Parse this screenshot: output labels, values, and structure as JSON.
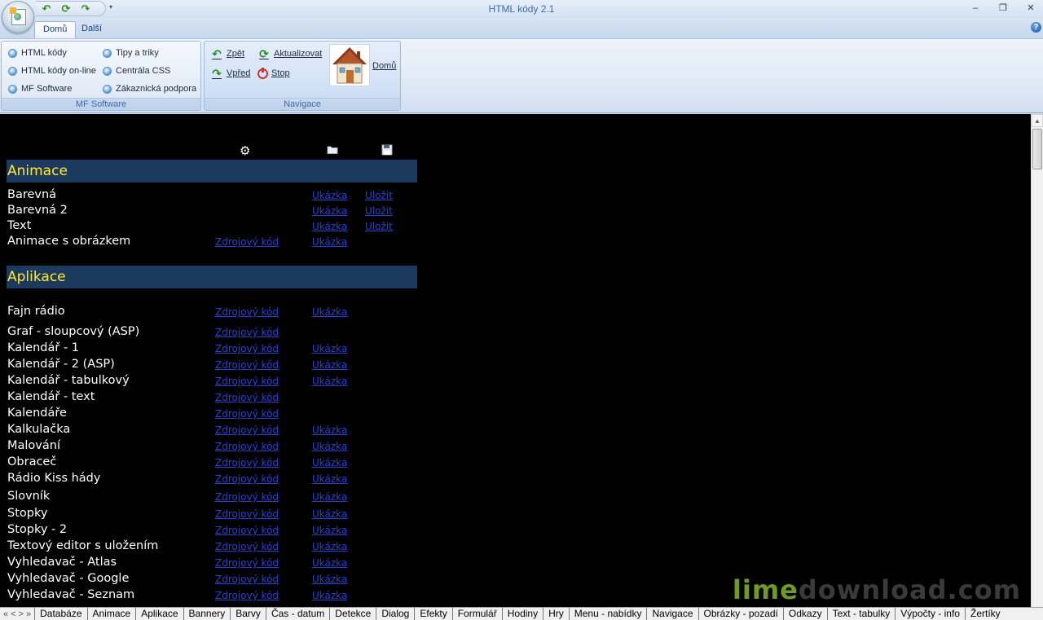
{
  "window": {
    "title": "HTML kódy 2.1",
    "controls": [
      "–",
      "❐",
      "✕"
    ]
  },
  "tabs": [
    {
      "label": "Domů",
      "active": true
    },
    {
      "label": "Další",
      "active": false
    }
  ],
  "ribbon": {
    "mf_group": {
      "label": "MF Software",
      "items": [
        "HTML kódy",
        "HTML kódy on-line",
        "MF Software",
        "Tipy a triky",
        "Centrála CSS",
        "Zákaznická podpora"
      ]
    },
    "nav_group": {
      "label": "Navigace",
      "back": "Zpět",
      "forward": "Vpřed",
      "refresh": "Aktualizovat",
      "stop": "Stop",
      "home": "Domů"
    }
  },
  "content": {
    "sections": [
      {
        "title": "Animace",
        "rows": [
          {
            "name": "Barevná",
            "source": null,
            "demo": "Ukázka",
            "save": "Uložit"
          },
          {
            "name": "Barevná 2",
            "source": null,
            "demo": "Ukázka",
            "save": "Uložit"
          },
          {
            "name": "Text",
            "source": null,
            "demo": "Ukázka",
            "save": "Uložit"
          },
          {
            "name": "Animace s obrázkem",
            "source": "Zdrojový kód",
            "demo": "Ukázka",
            "save": null
          }
        ]
      },
      {
        "title": "Aplikace",
        "rows": [
          {
            "name": "Fajn rádio",
            "source": "Zdrojový kód",
            "demo": "Ukázka"
          },
          {
            "name": "Graf - sloupcový (ASP)",
            "source": "Zdrojový kód",
            "demo": null
          },
          {
            "name": "Kalendář - 1",
            "source": "Zdrojový kód",
            "demo": "Ukázka"
          },
          {
            "name": "Kalendář - 2 (ASP)",
            "source": "Zdrojový kód",
            "demo": "Ukázka"
          },
          {
            "name": "Kalendář - tabulkový",
            "source": "Zdrojový kód",
            "demo": "Ukázka"
          },
          {
            "name": "Kalendář - text",
            "source": "Zdrojový kód",
            "demo": null
          },
          {
            "name": "Kalendáře",
            "source": "Zdrojový kód",
            "demo": null
          },
          {
            "name": "Kalkulačka",
            "source": "Zdrojový kód",
            "demo": "Ukázka"
          },
          {
            "name": "Malování",
            "source": "Zdrojový kód",
            "demo": "Ukázka"
          },
          {
            "name": "Obraceč",
            "source": "Zdrojový kód",
            "demo": "Ukázka"
          },
          {
            "name": "Rádio Kiss hády",
            "source": "Zdrojový kód",
            "demo": "Ukázka"
          },
          {
            "name": "Slovník",
            "source": "Zdrojový kód",
            "demo": "Ukázka"
          },
          {
            "name": "Stopky",
            "source": "Zdrojový kód",
            "demo": "Ukázka"
          },
          {
            "name": "Stopky - 2",
            "source": "Zdrojový kód",
            "demo": "Ukázka"
          },
          {
            "name": "Textový editor s uložením",
            "source": "Zdrojový kód",
            "demo": "Ukázka"
          },
          {
            "name": "Vyhledavač - Atlas",
            "source": "Zdrojový kód",
            "demo": "Ukázka"
          },
          {
            "name": "Vyhledavač - Google",
            "source": "Zdrojový kód",
            "demo": "Ukázka"
          },
          {
            "name": "Vyhledavač - Seznam",
            "source": "Zdrojový kód",
            "demo": "Ukázka"
          }
        ]
      }
    ]
  },
  "watermark": {
    "part1": "lime",
    "part2": "download.com"
  },
  "bottom_tabs": [
    "Databáze",
    "Animace",
    "Aplikace",
    "Bannery",
    "Barvy",
    "Čas - datum",
    "Detekce",
    "Dialog",
    "Efekty",
    "Formulář",
    "Hodiny",
    "Hry",
    "Menu - nabídky",
    "Navigace",
    "Obrázky - pozadí",
    "Odkazy",
    "Text - tabulky",
    "Výpočty - info",
    "Žertíky"
  ],
  "icons": {
    "app_orb": "html-document-globe-icon",
    "header_col1": "gear-icon",
    "header_col2": "folder-icon",
    "header_col3": "floppy-save-icon",
    "home": "house-icon"
  }
}
